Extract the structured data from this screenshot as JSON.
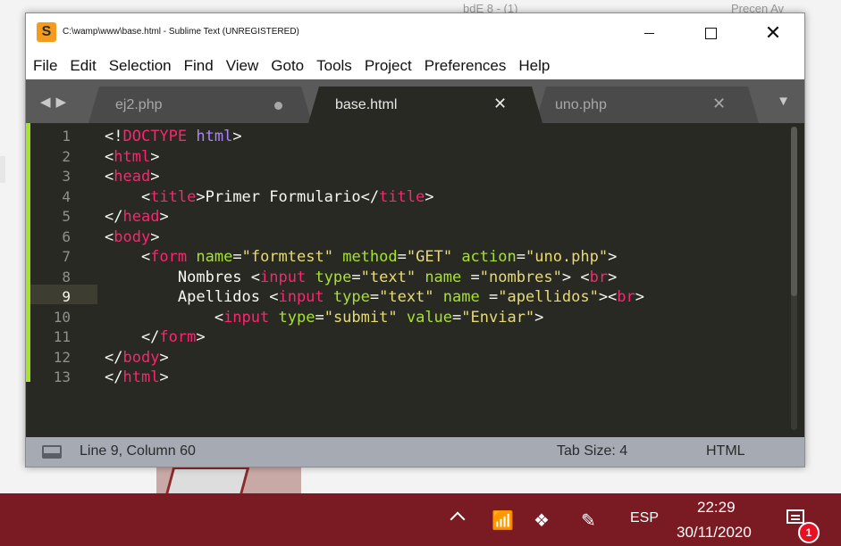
{
  "desktop": {
    "top_text_left": "bdE 8 - (1)",
    "top_text_right": "Precen Av"
  },
  "window": {
    "title": "C:\\wamp\\www\\base.html - Sublime Text (UNREGISTERED)",
    "app_icon_letter": "S"
  },
  "menu": [
    "File",
    "Edit",
    "Selection",
    "Find",
    "View",
    "Goto",
    "Tools",
    "Project",
    "Preferences",
    "Help"
  ],
  "tabs": [
    {
      "label": "ej2.php",
      "state": "dirty"
    },
    {
      "label": "base.html",
      "state": "active"
    },
    {
      "label": "uno.php",
      "state": "normal"
    }
  ],
  "editor": {
    "current_line": 9,
    "line_numbers": [
      "1",
      "2",
      "3",
      "4",
      "5",
      "6",
      "7",
      "8",
      "9",
      "10",
      "11",
      "12",
      "13"
    ],
    "lines": [
      [
        {
          "t": "<!",
          "c": "text"
        },
        {
          "t": "DOCTYPE",
          "c": "tag"
        },
        {
          "t": " ",
          "c": "text"
        },
        {
          "t": "html",
          "c": "doctype"
        },
        {
          "t": ">",
          "c": "text"
        }
      ],
      [
        {
          "t": "<",
          "c": "text"
        },
        {
          "t": "html",
          "c": "tag"
        },
        {
          "t": ">",
          "c": "text"
        }
      ],
      [
        {
          "t": "<",
          "c": "text"
        },
        {
          "t": "head",
          "c": "tag"
        },
        {
          "t": ">",
          "c": "text"
        }
      ],
      [
        {
          "t": "    <",
          "c": "text"
        },
        {
          "t": "title",
          "c": "tag"
        },
        {
          "t": ">Primer Formulario</",
          "c": "text"
        },
        {
          "t": "title",
          "c": "tag"
        },
        {
          "t": ">",
          "c": "text"
        }
      ],
      [
        {
          "t": "</",
          "c": "text"
        },
        {
          "t": "head",
          "c": "tag"
        },
        {
          "t": ">",
          "c": "text"
        }
      ],
      [
        {
          "t": "<",
          "c": "text"
        },
        {
          "t": "body",
          "c": "tag"
        },
        {
          "t": ">",
          "c": "text"
        }
      ],
      [
        {
          "t": "    <",
          "c": "text"
        },
        {
          "t": "form",
          "c": "tag"
        },
        {
          "t": " ",
          "c": "text"
        },
        {
          "t": "name",
          "c": "attr"
        },
        {
          "t": "=",
          "c": "text"
        },
        {
          "t": "\"formtest\"",
          "c": "str"
        },
        {
          "t": " ",
          "c": "text"
        },
        {
          "t": "method",
          "c": "attr"
        },
        {
          "t": "=",
          "c": "text"
        },
        {
          "t": "\"GET\"",
          "c": "str"
        },
        {
          "t": " ",
          "c": "text"
        },
        {
          "t": "action",
          "c": "attr"
        },
        {
          "t": "=",
          "c": "text"
        },
        {
          "t": "\"uno.php\"",
          "c": "str"
        },
        {
          "t": ">",
          "c": "text"
        }
      ],
      [
        {
          "t": "        Nombres <",
          "c": "text"
        },
        {
          "t": "input",
          "c": "tag"
        },
        {
          "t": " ",
          "c": "text"
        },
        {
          "t": "type",
          "c": "attr"
        },
        {
          "t": "=",
          "c": "text"
        },
        {
          "t": "\"text\"",
          "c": "str"
        },
        {
          "t": " ",
          "c": "text"
        },
        {
          "t": "name",
          "c": "attr"
        },
        {
          "t": " =",
          "c": "text"
        },
        {
          "t": "\"nombres\"",
          "c": "str"
        },
        {
          "t": "> <",
          "c": "text"
        },
        {
          "t": "br",
          "c": "tag"
        },
        {
          "t": ">",
          "c": "text"
        }
      ],
      [
        {
          "t": "        Apellidos <",
          "c": "text"
        },
        {
          "t": "input",
          "c": "tag"
        },
        {
          "t": " ",
          "c": "text"
        },
        {
          "t": "type",
          "c": "attr"
        },
        {
          "t": "=",
          "c": "text"
        },
        {
          "t": "\"text\"",
          "c": "str"
        },
        {
          "t": " ",
          "c": "text"
        },
        {
          "t": "name",
          "c": "attr"
        },
        {
          "t": " =",
          "c": "text"
        },
        {
          "t": "\"apellidos\"",
          "c": "str"
        },
        {
          "t": "><",
          "c": "text"
        },
        {
          "t": "br",
          "c": "tag"
        },
        {
          "t": ">",
          "c": "text"
        }
      ],
      [
        {
          "t": "            <",
          "c": "text"
        },
        {
          "t": "input",
          "c": "tag"
        },
        {
          "t": " ",
          "c": "text"
        },
        {
          "t": "type",
          "c": "attr"
        },
        {
          "t": "=",
          "c": "text"
        },
        {
          "t": "\"submit\"",
          "c": "str"
        },
        {
          "t": " ",
          "c": "text"
        },
        {
          "t": "value",
          "c": "attr"
        },
        {
          "t": "=",
          "c": "text"
        },
        {
          "t": "\"Enviar\"",
          "c": "str"
        },
        {
          "t": ">",
          "c": "text"
        }
      ],
      [
        {
          "t": "    </",
          "c": "text"
        },
        {
          "t": "form",
          "c": "tag"
        },
        {
          "t": ">",
          "c": "text"
        }
      ],
      [
        {
          "t": "</",
          "c": "text"
        },
        {
          "t": "body",
          "c": "tag"
        },
        {
          "t": ">",
          "c": "text"
        }
      ],
      [
        {
          "t": "</",
          "c": "text"
        },
        {
          "t": "html",
          "c": "tag"
        },
        {
          "t": ">",
          "c": "text"
        }
      ]
    ]
  },
  "status": {
    "position": "Line 9, Column 60",
    "tab_size": "Tab Size: 4",
    "syntax": "HTML"
  },
  "taskbar": {
    "language": "ESP",
    "time": "22:29",
    "date": "30/11/2020",
    "notification_count": "1"
  },
  "colors": {
    "editor_bg": "#282923",
    "tag": "#f92672",
    "attr": "#a6e22e",
    "string": "#e6db74",
    "doctype": "#ae81ff",
    "taskbar": "#7a1a22"
  }
}
